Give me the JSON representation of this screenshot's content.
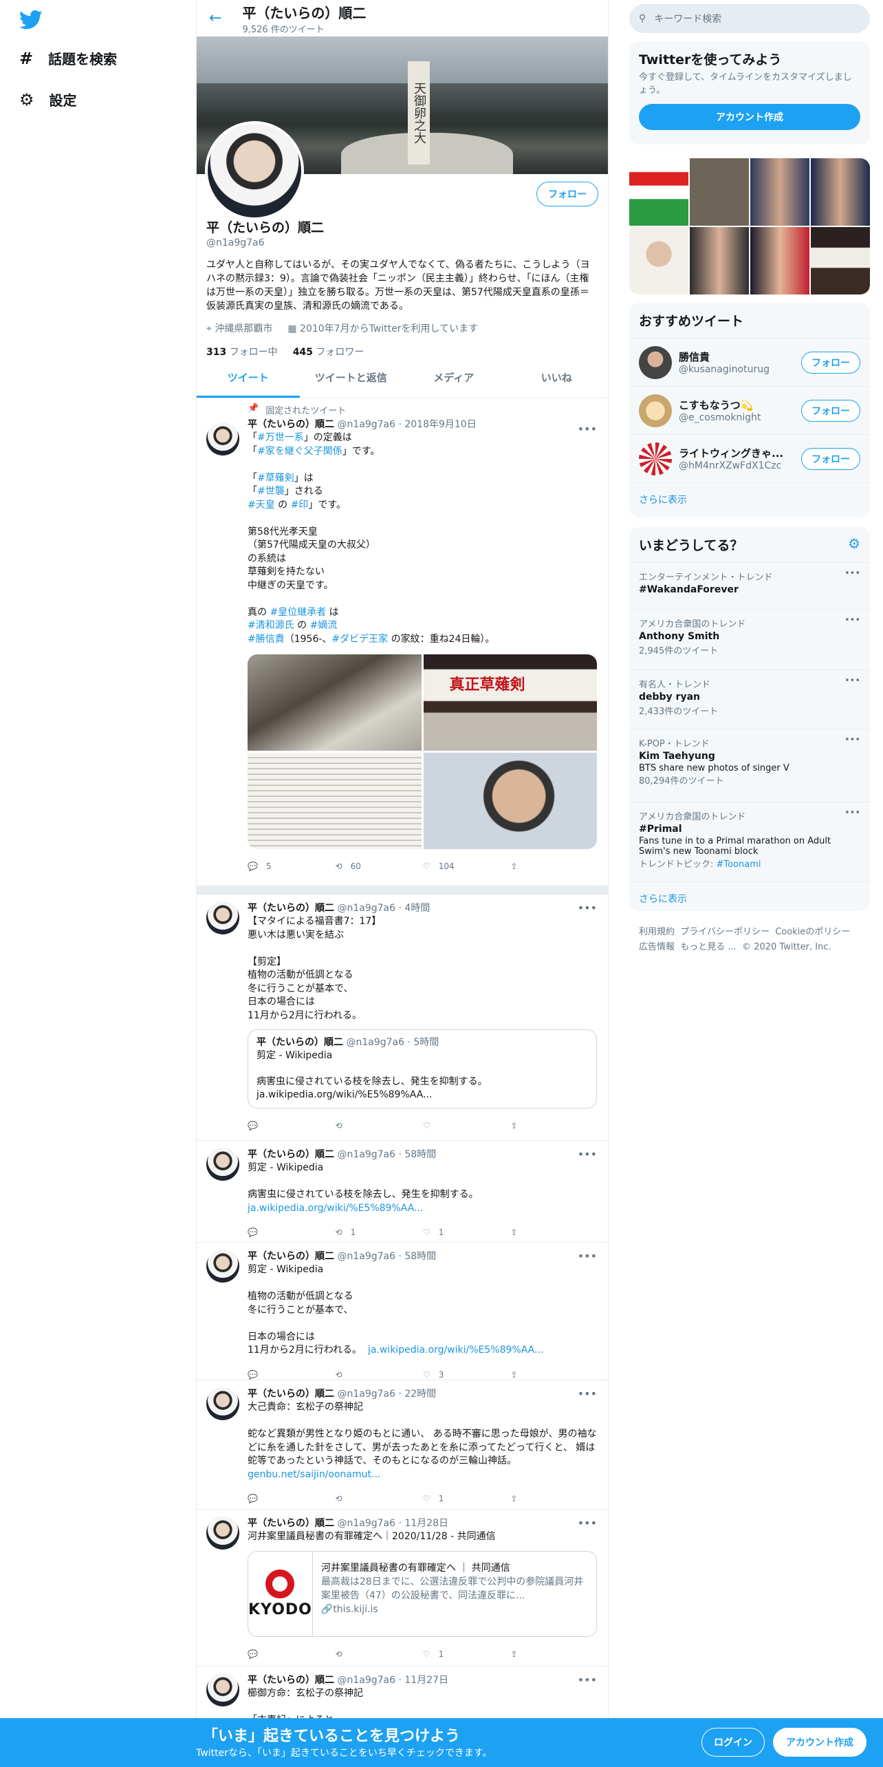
{
  "nav": {
    "explore": "話題を検索",
    "settings": "設定"
  },
  "header": {
    "name": "平（たいらの）順二",
    "tweet_count": "9,526 件のツイート"
  },
  "banner_text": "天御卵之大",
  "profile": {
    "follow_label": "フォロー",
    "name": "平（たいらの）順二",
    "handle": "@n1a9g7a6",
    "bio": "ユダヤ人と自称してはいるが、その実ユダヤ人でなくて、偽る者たちに、こうしよう（ヨハネの黙示録3：9）。言論で偽装社会「ニッポン（民主主義）」終わらせ、「にほん（主権は万世一系の天皇）」独立を勝ち取る。万世一系の天皇は、第57代陽成天皇直系の皇孫＝仮装源氏真実の皇族、清和源氏の嫡流である。",
    "location": "沖縄県那覇市",
    "joined": "2010年7月からTwitterを利用しています",
    "following_count": "313",
    "following_label": "フォロー中",
    "followers_count": "445",
    "followers_label": "フォロワー"
  },
  "tabs": [
    "ツイート",
    "ツイートと返信",
    "メディア",
    "いいね"
  ],
  "tweets": [
    {
      "pinned": "固定されたツイート",
      "name": "平（たいらの）順二",
      "handle": "@n1a9g7a6",
      "time": "2018年9月10日",
      "l1a": "「",
      "l1b": "#万世一系",
      "l1c": "」の定義は",
      "l2a": "「",
      "l2b": "#家を継ぐ父子関係",
      "l2c": "」です。",
      "l3a": "「",
      "l3b": "#草薙剣",
      "l3c": "」は",
      "l4a": "「",
      "l4b": "#世襲",
      "l4c": "」される",
      "l5a": "#天皇",
      "l5b": " の ",
      "l5c": "#印",
      "l5d": "」です。",
      "body2": "第58代光孝天皇\n（第57代陽成天皇の大叔父）\nの系統は\n草薙剣を持たない\n中継ぎの天皇です。",
      "l6a": "真の ",
      "l6b": "#皇位継承者",
      "l6c": " は",
      "l7a": "#清和源氏",
      "l7b": " の ",
      "l7c": "#嫡流",
      "l8a": "#勝信貴",
      "l8b": "（1956-、",
      "l8c": "#ダビデ王家",
      "l8d": " の家紋：重ね24日輪）。",
      "media_label": "真正草薙剣",
      "replies": "5",
      "retweets": "60",
      "likes": "104"
    },
    {
      "name": "平（たいらの）順二",
      "handle": "@n1a9g7a6",
      "time": "4時間",
      "body": "【マタイによる福音書7：17】\n悪い木は悪い実を結ぶ\n\n【剪定】\n植物の活動が低調となる\n冬に行うことが基本で、\n日本の場合には\n11月から2月に行われる。",
      "quote": {
        "name": "平（たいらの）順二",
        "handle": "@n1a9g7a6",
        "time": "5時間",
        "title": "剪定 - Wikipedia",
        "text": "病害虫に侵されている枝を除去し、発生を抑制する。",
        "link": "ja.wikipedia.org/wiki/%E5%89%AA..."
      }
    },
    {
      "name": "平（たいらの）順二",
      "handle": "@n1a9g7a6",
      "time": "58時間",
      "body": "剪定 - Wikipedia\n\n病害虫に侵されている枝を除去し、発生を抑制する。",
      "link": "ja.wikipedia.org/wiki/%E5%89%AA...",
      "retweets": "1",
      "likes": "1"
    },
    {
      "name": "平（たいらの）順二",
      "handle": "@n1a9g7a6",
      "time": "58時間",
      "body": "剪定 - Wikipedia\n\n植物の活動が低調となる\n冬に行うことが基本で、\n\n日本の場合には\n11月から2月に行われる。",
      "link": "ja.wikipedia.org/wiki/%E5%89%AA...",
      "likes": "3"
    },
    {
      "name": "平（たいらの）順二",
      "handle": "@n1a9g7a6",
      "time": "22時間",
      "body": "大己貴命：玄松子の祭神記\n\n蛇など異類が男性となり姫のもとに通い、 ある時不審に思った母娘が、男の袖などに糸を通した針をさして、男が去ったあとを糸に添ってたどって行くと、 婿は蛇等であったという神話で、そのもとになるのが三輪山神話。",
      "link": "genbu.net/saijin/oonamut...",
      "likes": "1"
    },
    {
      "name": "平（たいらの）順二",
      "handle": "@n1a9g7a6",
      "time": "11月28日",
      "body": "河井案里議員秘書の有罪確定へ｜2020/11/28 - 共同通信",
      "card": {
        "logo": "KYODO",
        "title": "河井案里議員秘書の有罪確定へ ｜ 共同通信",
        "desc": "最高裁は28日までに、公選法違反罪で公判中の参院議員河井案里被告（47）の公設秘書で、同法違反罪に...",
        "link": "this.kiji.is"
      },
      "likes": "1"
    },
    {
      "name": "平（たいらの）順二",
      "handle": "@n1a9g7a6",
      "time": "11月27日",
      "body": "櫛御方命：玄松子の祭神記\n\n「古事記」によると"
    }
  ],
  "right": {
    "search_placeholder": "キーワード検索",
    "signup_title": "Twitterを使ってみよう",
    "signup_text": "今すぐ登録して、タイムラインをカスタマイズしましょう。",
    "signup_button": "アカウント作成",
    "recommended_title": "おすすめツイート",
    "recommended": [
      {
        "name": "勝信貴",
        "handle": "@kusanaginoturug",
        "button": "フォロー"
      },
      {
        "name": "こすもなうつ💫",
        "handle": "@e_cosmoknight",
        "button": "フォロー"
      },
      {
        "name": "ライトウィングきゃ...",
        "handle": "@hM4nrXZwFdX1Czc",
        "button": "フォロー"
      }
    ],
    "show_more": "さらに表示",
    "trends_title": "いまどうしてる？",
    "trends": [
      {
        "context": "エンターテインメント・トレンド",
        "name": "#WakandaForever",
        "desc": "",
        "count": ""
      },
      {
        "context": "アメリカ合衆国のトレンド",
        "name": "Anthony Smith",
        "desc": "",
        "count": "2,945件のツイート"
      },
      {
        "context": "有名人・トレンド",
        "name": "debby ryan",
        "desc": "",
        "count": "2,433件のツイート"
      },
      {
        "context": "K-POP・トレンド",
        "name": "Kim Taehyung",
        "desc": "BTS share new photos of singer V",
        "count": "80,294件のツイート"
      },
      {
        "context": "アメリカ合衆国のトレンド",
        "name": "#Primal",
        "desc": "Fans tune in to a Primal marathon on Adult Swim's new Toonami block",
        "count": "",
        "topic_label": "トレンドトピック: ",
        "topic": "#Toonami"
      }
    ],
    "trends_more": "さらに表示",
    "footer1": "利用規約  プライバシーポリシー  Cookieのポリシー",
    "footer2": "広告情報  もっと見る ...  © 2020 Twitter, Inc."
  },
  "bottom": {
    "title": "「いま」起きていることを見つけよう",
    "sub": "Twitterなら、「いま」起きていることをいち早くチェックできます。",
    "login": "ログイン",
    "signup": "アカウント作成"
  },
  "colors": {
    "accent": "#1da1f2",
    "link": "#1b95e0",
    "text": "#14171a",
    "secondary": "#657786"
  }
}
